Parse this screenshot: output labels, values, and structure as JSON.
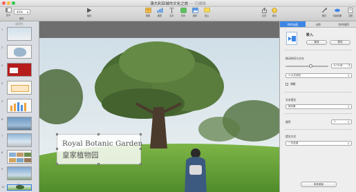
{
  "window": {
    "title": "澳大利亚城市文化之旅",
    "edited": "— 已编辑"
  },
  "toolbar": {
    "view_label": "显示",
    "zoom_value": "45%",
    "zoom_label": "缩放",
    "play_label": "播放",
    "table_label": "表格",
    "chart_label": "图表",
    "text_label": "文本",
    "shape_label": "形状",
    "media_label": "媒体",
    "comment_label": "批注",
    "share_label": "共享",
    "tips_label": "提示",
    "format_label": "格式",
    "animate_label": "动画效果",
    "document_label": "文稿"
  },
  "navigator": {
    "header": "幻灯片",
    "slides": [
      "1",
      "2",
      "3",
      "4",
      "5",
      "6",
      "7",
      "8",
      "9",
      "10"
    ],
    "selected": "10",
    "add_icon": "plus-icon"
  },
  "slide": {
    "caption_en": "Royal Botanic Garden",
    "caption_zh": "皇家植物园"
  },
  "inspector": {
    "tabs": [
      "构件动画",
      "动作",
      "构件顺序"
    ],
    "active_tab": "构件动画",
    "effect_title": "移入",
    "change_button": "更改",
    "preview_button": "预览",
    "duration_label": "移动时间与方向",
    "duration_value": "0.75 秒",
    "direction_value": "从左到右",
    "bounce_label": "弹跳",
    "delivery_label": "文本提交",
    "delivery_value": "按对象",
    "order_label": "顺序",
    "order_value": "1",
    "start_label": "提交方式",
    "start_value": "一次全部",
    "build_order_button": "构件顺序"
  },
  "colors": {
    "accent": "#3d86e6",
    "sky": "#d6e3ea",
    "grass": "#6fa83f",
    "canvas_bg": "#6e6e6e"
  }
}
